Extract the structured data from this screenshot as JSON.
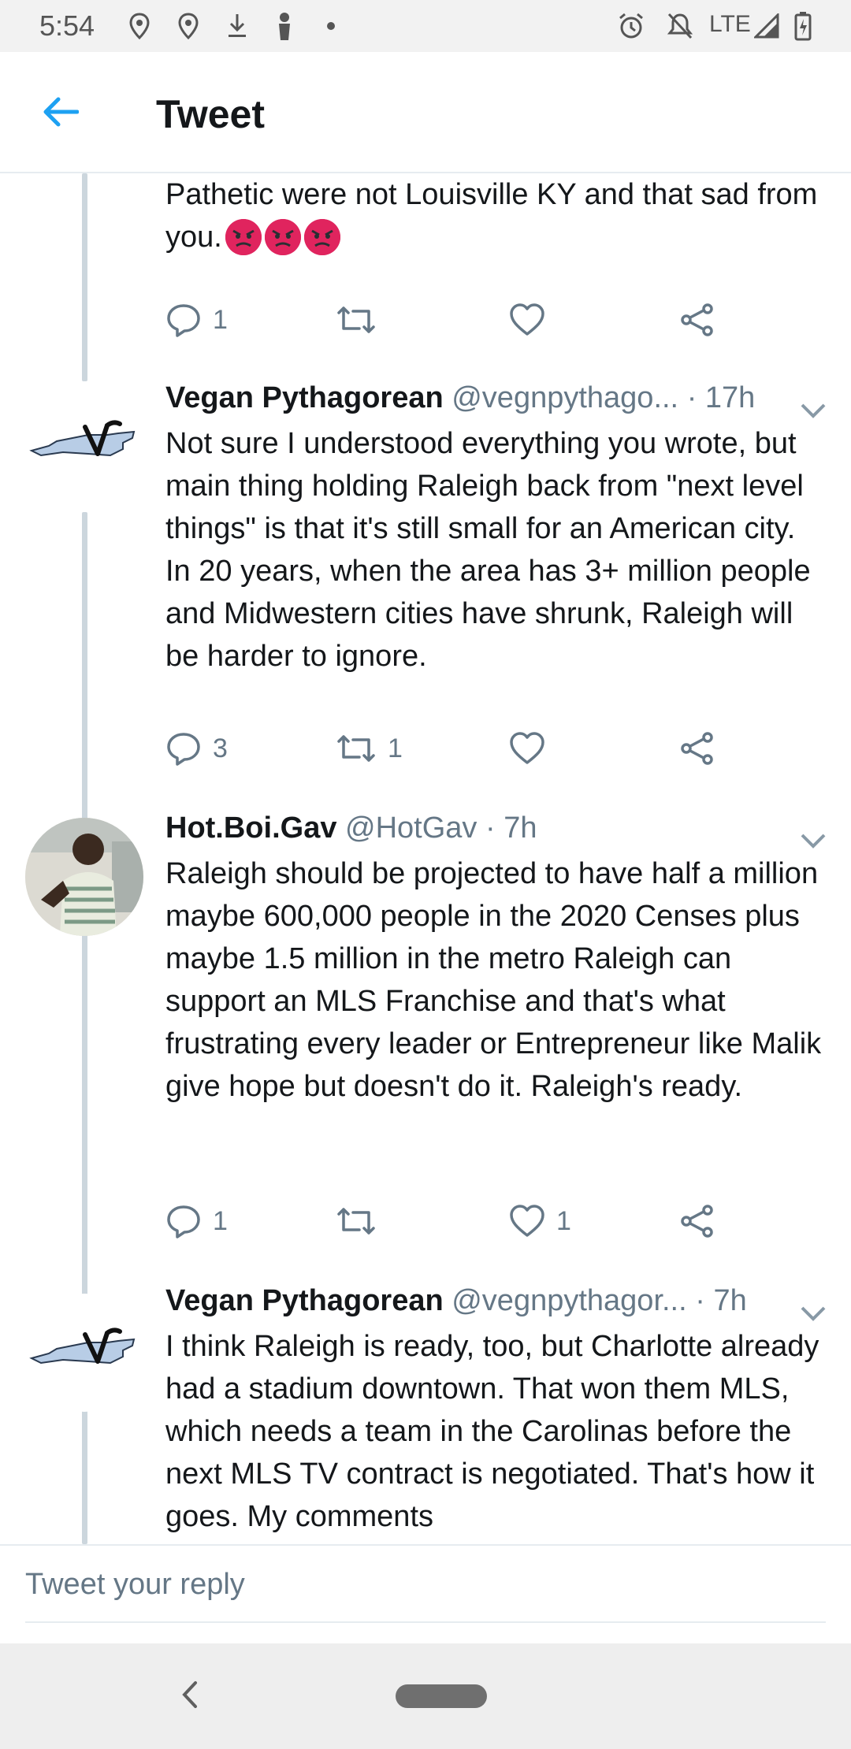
{
  "status_bar": {
    "time": "5:54",
    "network": "LTE",
    "icons": [
      "location-icon",
      "location-icon",
      "download-icon",
      "person-icon",
      "dot-icon",
      "alarm-icon",
      "notifications-off-icon",
      "signal-icon",
      "battery-icon"
    ]
  },
  "header": {
    "title": "Tweet",
    "back_icon": "back-arrow-icon"
  },
  "tweets": [
    {
      "text": "Pathetic were not Louisville KY and that sad from you.",
      "emoji": [
        "angry-face",
        "angry-face",
        "angry-face"
      ],
      "actions": {
        "reply": "1",
        "retweet": "",
        "like": ""
      }
    },
    {
      "name": "Vegan Pythagorean",
      "handle": "@vegnpythago...",
      "time": "· 17h",
      "text": "Not sure I understood everything you wrote, but main thing holding Raleigh back from \"next level things\" is that it's still small for an American city. In 20 years, when the area has 3+ million people and Midwestern cities have shrunk, Raleigh will be harder to ignore.",
      "actions": {
        "reply": "3",
        "retweet": "1",
        "like": ""
      }
    },
    {
      "name": "Hot.Boi.Gav",
      "handle": "@HotGav",
      "time": "· 7h",
      "text": "Raleigh should be projected to have half a million maybe 600,000 people in the 2020 Censes plus maybe 1.5 million in the metro Raleigh can support an MLS Franchise and that's what frustrating every leader or Entrepreneur like Malik give hope but doesn't do it. Raleigh's ready.",
      "actions": {
        "reply": "1",
        "retweet": "",
        "like": "1"
      }
    },
    {
      "name": "Vegan Pythagorean",
      "handle": "@vegnpythagor...",
      "time": "· 7h",
      "text": "I think Raleigh is ready, too, but Charlotte already had a stadium downtown. That won them MLS, which needs a team in the Carolinas before the next MLS TV contract is negotiated. That's how it goes. My comments"
    }
  ],
  "reply_bar": {
    "placeholder": "Tweet your reply"
  },
  "colors": {
    "accent": "#1da1f2",
    "secondary_text": "#657786",
    "thread_line": "#ccd6dd",
    "angry_emoji": "#e0245e"
  }
}
